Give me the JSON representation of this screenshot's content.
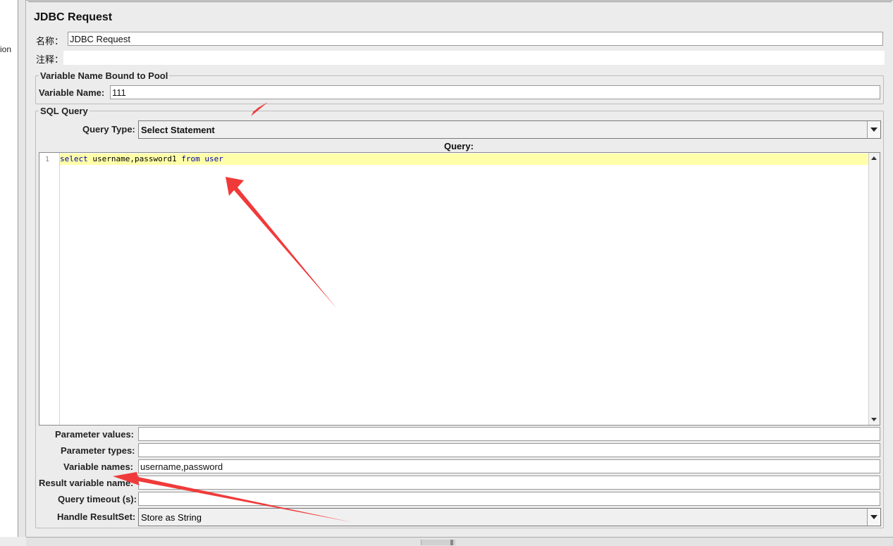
{
  "left_panel": {
    "cut_label": "ion"
  },
  "header": {
    "title": "JDBC Request"
  },
  "name_field": {
    "label": "名称：",
    "value": "JDBC Request"
  },
  "comment_field": {
    "label": "注释：",
    "value": ""
  },
  "pool_group": {
    "legend": "Variable Name Bound to Pool",
    "variable_name_label": "Variable Name:",
    "variable_name_value": "111"
  },
  "sql_group": {
    "legend": "SQL Query",
    "query_type_label": "Query Type:",
    "query_type_value": "Select Statement",
    "query_header": "Query:",
    "editor": {
      "line_number": "1",
      "tokens": [
        "select",
        " username,password1 ",
        "from",
        " user"
      ]
    },
    "params": [
      {
        "label": "Parameter values:",
        "value": ""
      },
      {
        "label": "Parameter types:",
        "value": ""
      },
      {
        "label": "Variable names:",
        "value": "username,password"
      },
      {
        "label": "Result variable name:",
        "value": ""
      },
      {
        "label": "Query timeout (s):",
        "value": ""
      }
    ],
    "handle_resultset_label": "Handle ResultSet:",
    "handle_resultset_value": "Store as String"
  },
  "colors": {
    "background": "#ececec",
    "current_line_highlight": "#ffffaa",
    "sql_keyword": "#0000aa",
    "annotation_arrow": "#f03a3a"
  }
}
